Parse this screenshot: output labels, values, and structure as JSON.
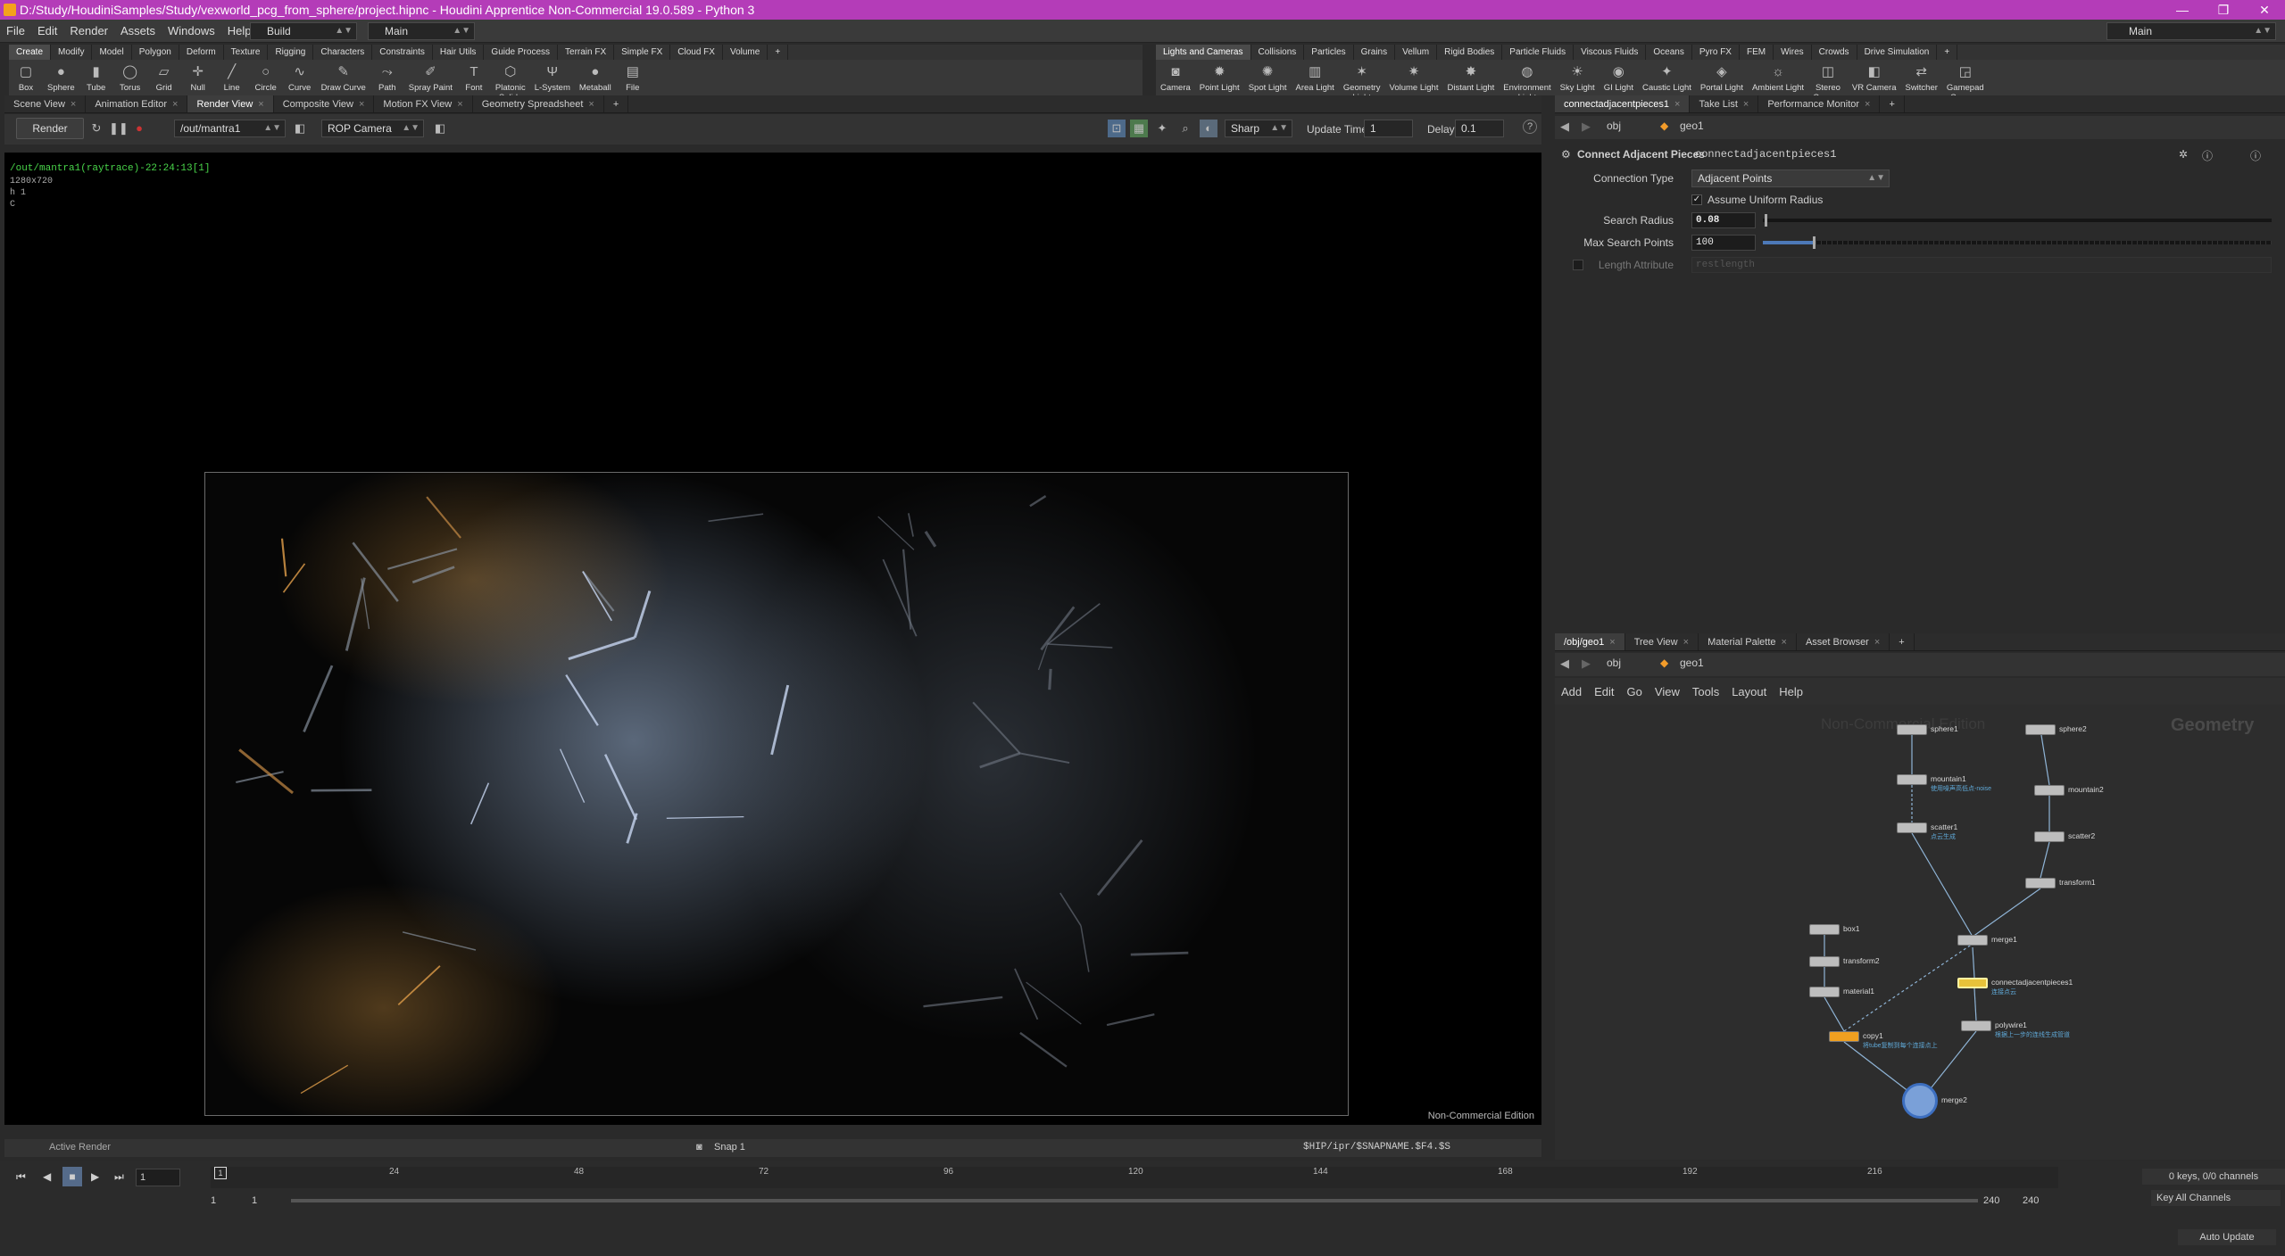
{
  "title": "D:/Study/HoudiniSamples/Study/vexworld_pcg_from_sphere/project.hipnc - Houdini Apprentice Non-Commercial 19.0.589 - Python 3",
  "window_controls": [
    "—",
    "❐",
    "✕"
  ],
  "menus": [
    "File",
    "Edit",
    "Render",
    "Assets",
    "Windows",
    "Help"
  ],
  "desktop_build": "Build",
  "desktop_main": "Main",
  "desktop_right": "Main",
  "shelf_left_tabs": [
    "Create",
    "Modify",
    "Model",
    "Polygon",
    "Deform",
    "Texture",
    "Rigging",
    "Characters",
    "Constraints",
    "Hair Utils",
    "Guide Process",
    "Terrain FX",
    "Simple FX",
    "Cloud FX",
    "Volume",
    "+"
  ],
  "shelf_left_tools": [
    {
      "label": "Box",
      "icon": "▢"
    },
    {
      "label": "Sphere",
      "icon": "●"
    },
    {
      "label": "Tube",
      "icon": "▮"
    },
    {
      "label": "Torus",
      "icon": "◯"
    },
    {
      "label": "Grid",
      "icon": "▱"
    },
    {
      "label": "Null",
      "icon": "✛"
    },
    {
      "label": "Line",
      "icon": "╱"
    },
    {
      "label": "Circle",
      "icon": "○"
    },
    {
      "label": "Curve",
      "icon": "∿"
    },
    {
      "label": "Draw Curve",
      "icon": "✎"
    },
    {
      "label": "Path",
      "icon": "⤳"
    },
    {
      "label": "Spray Paint",
      "icon": "✐"
    },
    {
      "label": "Font",
      "icon": "T"
    },
    {
      "label": "Platonic\nSolids",
      "icon": "⬡"
    },
    {
      "label": "L-System",
      "icon": "Ψ"
    },
    {
      "label": "Metaball",
      "icon": "●"
    },
    {
      "label": "File",
      "icon": "▤"
    }
  ],
  "shelf_right_tabs": [
    "Lights and Cameras",
    "Collisions",
    "Particles",
    "Grains",
    "Vellum",
    "Rigid Bodies",
    "Particle Fluids",
    "Viscous Fluids",
    "Oceans",
    "Pyro FX",
    "FEM",
    "Wires",
    "Crowds",
    "Drive Simulation",
    "+"
  ],
  "shelf_right_tools": [
    {
      "label": "Camera",
      "icon": "◙"
    },
    {
      "label": "Point Light",
      "icon": "✹"
    },
    {
      "label": "Spot Light",
      "icon": "✺"
    },
    {
      "label": "Area Light",
      "icon": "▥"
    },
    {
      "label": "Geometry\nLight",
      "icon": "✶"
    },
    {
      "label": "Volume Light",
      "icon": "✷"
    },
    {
      "label": "Distant Light",
      "icon": "✸"
    },
    {
      "label": "Environment\nLight",
      "icon": "◍"
    },
    {
      "label": "Sky Light",
      "icon": "☀"
    },
    {
      "label": "GI Light",
      "icon": "◉"
    },
    {
      "label": "Caustic Light",
      "icon": "✦"
    },
    {
      "label": "Portal Light",
      "icon": "◈"
    },
    {
      "label": "Ambient Light",
      "icon": "☼"
    },
    {
      "label": "Stereo\nCamera",
      "icon": "◫"
    },
    {
      "label": "VR Camera",
      "icon": "◧"
    },
    {
      "label": "Switcher",
      "icon": "⇄"
    },
    {
      "label": "Gamepad\nCamera",
      "icon": "◲"
    }
  ],
  "left_pane_tabs": [
    "Scene View",
    "Animation Editor",
    "Render View",
    "Composite View",
    "Motion FX View",
    "Geometry Spreadsheet",
    "+"
  ],
  "render_toolbar": {
    "render_label": "Render",
    "out_path": "/out/mantra1",
    "camera": "ROP Camera",
    "sharp": "Sharp",
    "update_time_label": "Update Time",
    "update_time_value": "1",
    "delay_label": "Delay",
    "delay_value": "0.1"
  },
  "render_overlay": {
    "line1": "/out/mantra1(raytrace)-22:24:13[1]",
    "line2": "1280x720",
    "line3": "h 1",
    "line4": "C"
  },
  "watermark": "Non-Commercial Edition",
  "render_bottom": {
    "active_render": "Active Render",
    "snap": "Snap 1",
    "ipr_path": "$HIP/ipr/$SNAPNAME.$F4.$S"
  },
  "right_top_tabs": [
    "connectadjacentpieces1",
    "Take List",
    "Performance Monitor",
    "+"
  ],
  "path_obj": "obj",
  "path_geo": "geo1",
  "param_header": {
    "type": "Connect Adjacent Pieces",
    "name": "connectadjacentpieces1"
  },
  "params": {
    "connection_type_label": "Connection Type",
    "connection_type_value": "Adjacent Points",
    "assume_uniform": "Assume Uniform Radius",
    "search_radius_label": "Search Radius",
    "search_radius_value": "0.08",
    "max_search_label": "Max Search Points",
    "max_search_value": "100",
    "length_attr_label": "Length Attribute",
    "length_attr_value": "restlength"
  },
  "network_tabs": [
    "/obj/geo1",
    "Tree View",
    "Material Palette",
    "Asset Browser",
    "+"
  ],
  "network_menu": [
    "Add",
    "Edit",
    "Go",
    "View",
    "Tools",
    "Layout",
    "Help"
  ],
  "network_watermark": "Non-Commercial Edition",
  "network_context": "Geometry",
  "nodes": [
    {
      "name": "sphere1",
      "sub": ""
    },
    {
      "name": "mountain1",
      "sub": "使用噪声高低点-noise"
    },
    {
      "name": "scatter1",
      "sub": "点云生成"
    },
    {
      "name": "sphere2",
      "sub": ""
    },
    {
      "name": "mountain2",
      "sub": ""
    },
    {
      "name": "scatter2",
      "sub": ""
    },
    {
      "name": "transform1",
      "sub": ""
    },
    {
      "name": "merge1",
      "sub": ""
    },
    {
      "name": "connectadjacentpieces1",
      "sub": "连接点云"
    },
    {
      "name": "box1",
      "sub": ""
    },
    {
      "name": "transform2",
      "sub": ""
    },
    {
      "name": "material1",
      "sub": ""
    },
    {
      "name": "copy1",
      "sub": "将tube复制到每个连接点上"
    },
    {
      "name": "polywire1",
      "sub": "根据上一步的连线生成管道"
    },
    {
      "name": "merge2",
      "sub": ""
    }
  ],
  "timeline": {
    "ticks": [
      "24",
      "48",
      "72",
      "96",
      "120",
      "144",
      "168",
      "192",
      "216"
    ],
    "current_frame": "1",
    "start": "1",
    "start2": "1",
    "end": "240",
    "end2": "240",
    "keys": "0 keys, 0/0 channels",
    "key_all": "Key All Channels",
    "auto_update": "Auto Update"
  }
}
